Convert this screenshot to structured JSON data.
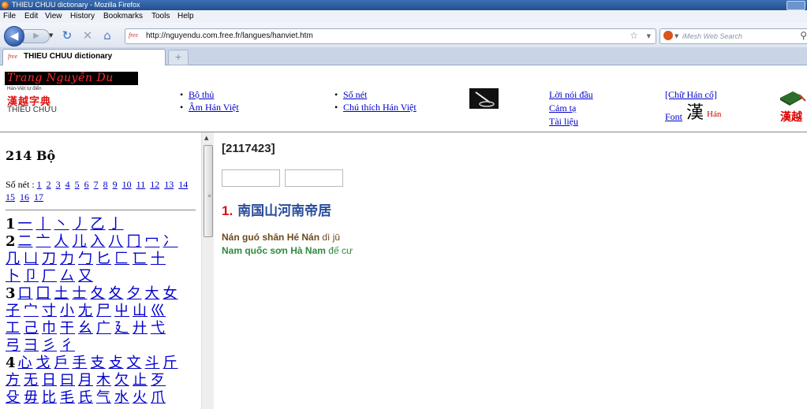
{
  "window": {
    "title": "THIEU CHUU dictionary - Mozilla Firefox"
  },
  "menu": [
    "File",
    "Edit",
    "View",
    "History",
    "Bookmarks",
    "Tools",
    "Help"
  ],
  "nav": {
    "url": "http://nguyendu.com.free.fr/langues/hanviet.htm",
    "favicon_text": "free",
    "search_placeholder": "iMesh Web Search"
  },
  "tab": {
    "title": "THIEU CHUU dictionary",
    "new_tab": "+"
  },
  "header": {
    "logo_bar": "Trang Nguyễn Du",
    "logo_small": "Hán-Việt tự điển",
    "logo_cjk": "漢越字典",
    "logo_name": "THIỀU CHỬU",
    "links_col1": [
      "Bộ thủ",
      "Âm Hán Việt"
    ],
    "links_col2": [
      "Số nét",
      "Chú thích Hán Việt"
    ],
    "links_col3": [
      "Lời nói đầu",
      "Cảm tạ",
      "Tài liệu"
    ],
    "chu_han_co": "[Chữ Hán cổ]",
    "font_label": "Font",
    "han_big": "漢",
    "han_red": "Hán",
    "hanviet_red": "漢越"
  },
  "left": {
    "title": "214 Bộ",
    "so_net_label": "Số nét :",
    "so_net_numbers": [
      "1",
      "2",
      "3",
      "4",
      "5",
      "6",
      "7",
      "8",
      "9",
      "10",
      "11",
      "12",
      "13",
      "14",
      "15",
      "16",
      "17"
    ],
    "radical_rows": [
      {
        "num": "1",
        "chars": [
          "一",
          "丨",
          "丶",
          "丿",
          "乙",
          "亅"
        ]
      },
      {
        "num": "2",
        "chars": [
          "二",
          "亠",
          "人",
          "儿",
          "入",
          "八",
          "冂",
          "冖",
          "冫"
        ]
      },
      {
        "num": "",
        "chars": [
          "几",
          "凵",
          "刀",
          "力",
          "勹",
          "匕",
          "匚",
          "匸",
          "十"
        ]
      },
      {
        "num": "",
        "chars": [
          "卜",
          "卩",
          "厂",
          "厶",
          "又"
        ]
      },
      {
        "num": "3",
        "chars": [
          "口",
          "囗",
          "土",
          "士",
          "夂",
          "夊",
          "夕",
          "大",
          "女"
        ]
      },
      {
        "num": "",
        "chars": [
          "子",
          "宀",
          "寸",
          "小",
          "尢",
          "尸",
          "屮",
          "山",
          "巛"
        ]
      },
      {
        "num": "",
        "chars": [
          "工",
          "己",
          "巾",
          "干",
          "幺",
          "广",
          "廴",
          "廾",
          "弋"
        ]
      },
      {
        "num": "",
        "chars": [
          "弓",
          "彐",
          "彡",
          "彳"
        ]
      },
      {
        "num": "4",
        "chars": [
          "心",
          "戈",
          "戶",
          "手",
          "支",
          "攴",
          "文",
          "斗",
          "斤"
        ]
      },
      {
        "num": "",
        "chars": [
          "方",
          "无",
          "日",
          "曰",
          "月",
          "木",
          "欠",
          "止",
          "歹"
        ]
      },
      {
        "num": "",
        "chars": [
          "殳",
          "毋",
          "比",
          "毛",
          "氏",
          "气",
          "水",
          "火",
          "爪"
        ]
      }
    ]
  },
  "main": {
    "code": "[2117423]",
    "entry_number": "1.",
    "entry_text": "南国山河南帝居",
    "pinyin_bold1": "Nán guó shān",
    "pinyin_bold2": "Hé Nán",
    "pinyin_rest": "dì jū",
    "hanviet_bold1": "Nam quốc sơn",
    "hanviet_bold2": "Hà Nam",
    "hanviet_rest": "đế cư"
  }
}
